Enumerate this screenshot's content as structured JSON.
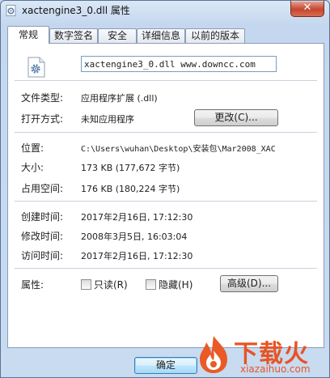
{
  "window": {
    "title": "xactengine3_0.dll 属性",
    "close_glyph": "✕"
  },
  "tabs": [
    {
      "label": "常规",
      "active": true
    },
    {
      "label": "数字签名",
      "active": false
    },
    {
      "label": "安全",
      "active": false
    },
    {
      "label": "详细信息",
      "active": false
    },
    {
      "label": "以前的版本",
      "active": false
    }
  ],
  "general": {
    "file_name_value": "xactengine3_0.dll  www.downcc.com",
    "file_type_label": "文件类型:",
    "file_type_value": "应用程序扩展 (.dll)",
    "opens_with_label": "打开方式:",
    "opens_with_value": "未知应用程序",
    "change_button": "更改(C)...",
    "location_label": "位置:",
    "location_value": "C:\\Users\\wuhan\\Desktop\\安装包\\Mar2008_XAC",
    "size_label": "大小:",
    "size_value": "173 KB (177,672 字节)",
    "size_on_disk_label": "占用空间:",
    "size_on_disk_value": "176 KB (180,224 字节)",
    "created_label": "创建时间:",
    "created_value": "2017年2月16日, 17:12:30",
    "modified_label": "修改时间:",
    "modified_value": "2008年3月5日, 16:03:04",
    "accessed_label": "访问时间:",
    "accessed_value": "2017年2月16日, 17:12:30",
    "attributes_label": "属性:",
    "readonly_label": "只读(R)",
    "hidden_label": "隐藏(H)",
    "advanced_button": "高级(D)..."
  },
  "footer": {
    "ok_button": "确定"
  },
  "watermark": {
    "brand": "下载火",
    "domain": "xiazaihuo.com"
  },
  "icons": {
    "title": "dll-gear-icon",
    "file": "dll-gear-icon",
    "watermark": "fire-logo-icon"
  },
  "colors": {
    "accent": "#e85424",
    "frame": "#c8dbf1",
    "close": "#c5462f"
  }
}
